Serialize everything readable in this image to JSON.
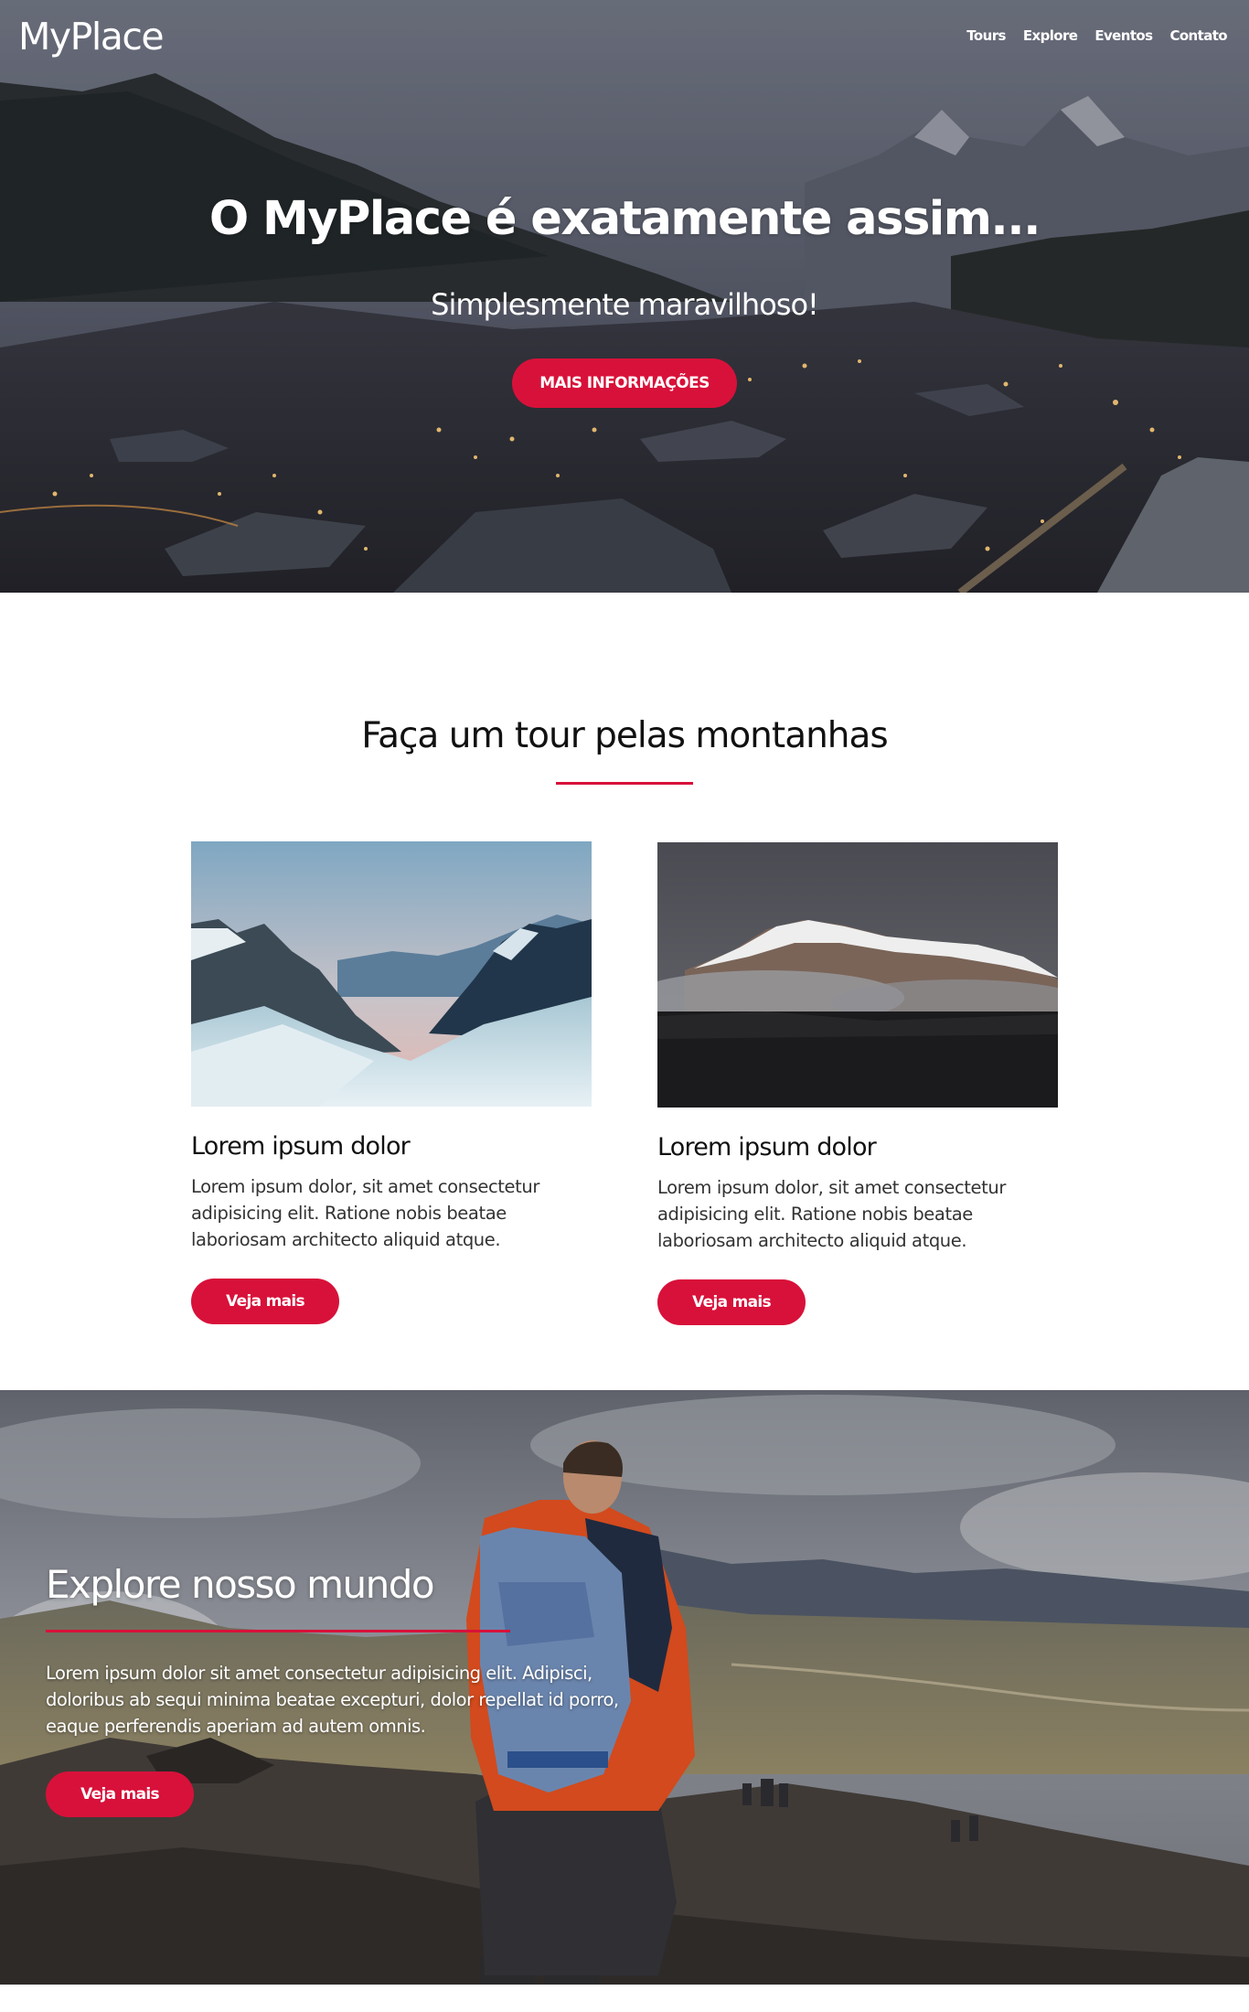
{
  "header": {
    "brand": "MyPlace",
    "nav": [
      "Tours",
      "Explore",
      "Eventos",
      "Contato"
    ]
  },
  "hero": {
    "title": "O MyPlace é exatamente assim...",
    "subtitle": "Simplesmente maravilhoso!",
    "button_label": "MAIS INFORMAÇÕES"
  },
  "tours": {
    "title": "Faça um tour pelas montanhas",
    "cards": [
      {
        "title": "Lorem ipsum dolor",
        "text": "Lorem ipsum dolor, sit amet consectetur adipisicing elit. Ratione nobis beatae laboriosam architecto aliquid atque.",
        "button_label": "Veja mais"
      },
      {
        "title": "Lorem ipsum dolor",
        "text": "Lorem ipsum dolor, sit amet consectetur adipisicing elit. Ratione nobis beatae laboriosam architecto aliquid atque.",
        "button_label": "Veja mais"
      }
    ]
  },
  "explore": {
    "title": "Explore nosso mundo",
    "text": "Lorem ipsum dolor sit amet consectetur adipisicing elit. Adipisci, doloribus ab sequi minima beatae excepturi, dolor repellat id porro, eaque perferendis aperiam ad autem omnis.",
    "button_label": "Veja mais"
  },
  "colors": {
    "accent": "#d8113a",
    "text": "#111111",
    "muted_text": "#333333",
    "background": "#ffffff"
  }
}
